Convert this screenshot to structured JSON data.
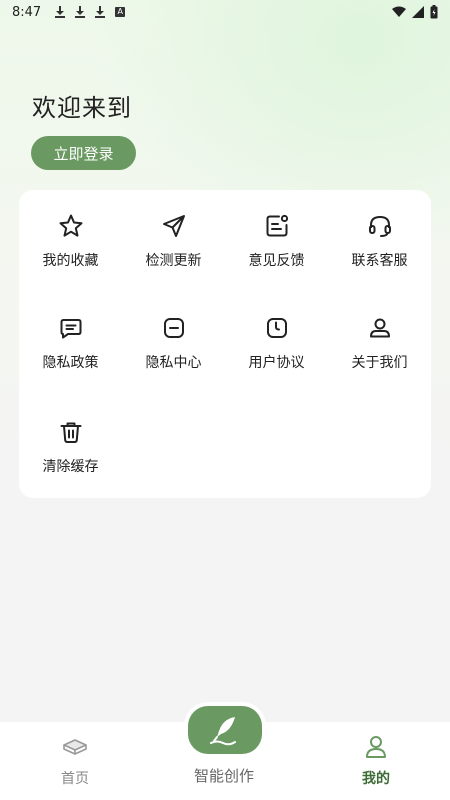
{
  "status_bar": {
    "time": "8:47",
    "badge_letter": "A"
  },
  "header": {
    "welcome_text": "欢迎来到",
    "login_label": "立即登录"
  },
  "menu": {
    "items": [
      {
        "label": "我的收藏",
        "icon": "star-icon"
      },
      {
        "label": "检测更新",
        "icon": "send-icon"
      },
      {
        "label": "意见反馈",
        "icon": "feedback-icon"
      },
      {
        "label": "联系客服",
        "icon": "headset-icon"
      },
      {
        "label": "隐私政策",
        "icon": "message-icon"
      },
      {
        "label": "隐私中心",
        "icon": "minus-box-icon"
      },
      {
        "label": "用户协议",
        "icon": "agreement-icon"
      },
      {
        "label": "关于我们",
        "icon": "user-icon"
      },
      {
        "label": "清除缓存",
        "icon": "trash-icon"
      }
    ]
  },
  "bottom_nav": {
    "home_label": "首页",
    "create_label": "智能创作",
    "mine_label": "我的"
  },
  "colors": {
    "accent": "#6a9a62",
    "text": "#222222",
    "muted": "#888888"
  }
}
